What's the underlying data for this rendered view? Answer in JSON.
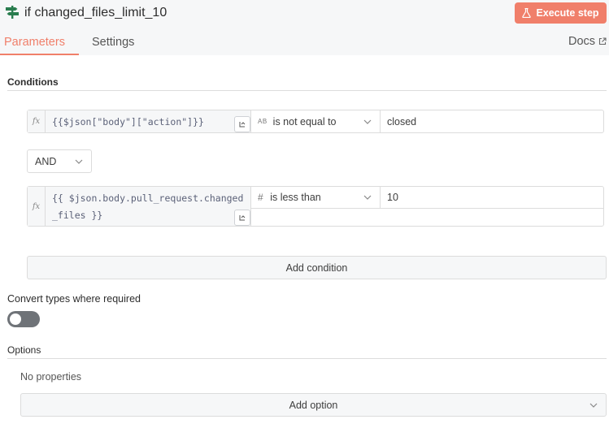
{
  "header": {
    "node_title": "if changed_files_limit_10",
    "execute_label": "Execute step",
    "node_icon": "signpost-icon",
    "accent_color": "#f07f6a"
  },
  "tabs": [
    {
      "label": "Parameters",
      "active": true
    },
    {
      "label": "Settings",
      "active": false
    }
  ],
  "docs_label": "Docs",
  "conditions": {
    "label": "Conditions",
    "rows": [
      {
        "fx": "fx",
        "expression": "{{$json[\"body\"][\"action\"]}}",
        "operator_icon": "AB",
        "operator": "is not equal to",
        "value": "closed"
      },
      {
        "fx": "fx",
        "expression": "{{ $json.body.pull_request.changed_files }}",
        "operator_icon": "#",
        "operator": "is less than",
        "value": "10"
      }
    ],
    "combinator": "AND",
    "add_condition_label": "Add condition"
  },
  "convert_types": {
    "label": "Convert types where required",
    "enabled": false
  },
  "options": {
    "label": "Options",
    "empty_text": "No properties",
    "add_option_label": "Add option"
  }
}
